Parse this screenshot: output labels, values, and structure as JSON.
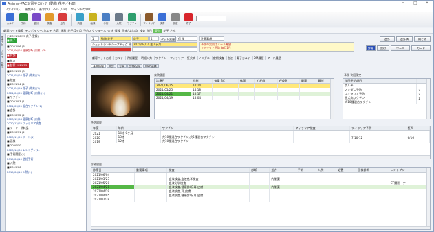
{
  "window": {
    "title": "Animal-PACS 電子カルテ [動物 花子／4/6]",
    "min": "─",
    "max": "□",
    "close": "✕"
  },
  "menu": [
    "ファイル(F)",
    "編集(E)",
    "表示(V)",
    "ヘルプ(H)",
    "ウィンドウ(W)"
  ],
  "toolbar": [
    {
      "label": "カルテ",
      "color": "#3b6fd6"
    },
    {
      "label": "予約",
      "color": "#2d8f3a"
    },
    {
      "label": "会計",
      "color": "#7a4ac7"
    },
    {
      "label": "検査",
      "color": "#e29a2b"
    },
    {
      "label": "処方",
      "color": "#d83c3c"
    },
    {
      "label": "病名",
      "color": "#3aa0c8"
    },
    {
      "label": "画像",
      "color": "#c9b21f"
    },
    {
      "label": "手術",
      "color": "#4b7fc4"
    },
    {
      "label": "入院",
      "color": "#6c7a89"
    },
    {
      "label": "ワクチン",
      "color": "#2f9e6d"
    },
    {
      "label": "フィラリア",
      "color": "#8b5a2b"
    },
    {
      "label": "文書",
      "color": "#3b6fd6"
    },
    {
      "label": "設定",
      "color": "#888888"
    },
    {
      "label": "終了",
      "color": "#d8252b"
    }
  ],
  "bar2": {
    "items": [
      "顧客ペット検索",
      "テンポラリー/カルテ",
      "内容",
      "順番",
      "花子/5ヶ月",
      "予約スケジュール",
      "会計",
      "保険",
      "再来/はな/次",
      "検査 当日",
      "受付",
      "花子 さん"
    ],
    "green_index": 10
  },
  "side": {
    "tabs": [
      "患者ナビ",
      "カルテ",
      "設定"
    ],
    "tree": [
      {
        "t": "□ 2021/06/15 花子(登録)",
        "c": "#222"
      },
      {
        "t": "■ 花子",
        "c": "#fff",
        "bg": "#2fa33a"
      },
      {
        "t": "■ 2021/06 (6)",
        "c": "#222"
      },
      {
        "t": "  2021/06/04 健康診断 (内科) (3)",
        "c": "#c0282f"
      },
      {
        "t": "■ 体調",
        "c": "#fff",
        "bg": "#c0282f"
      },
      {
        "t": "■ 処方",
        "c": "#222"
      },
      {
        "t": "■ 診察 2021/05",
        "c": "#fff",
        "bg": "#c0282f"
      },
      {
        "t": "■ 2021/05 (3)",
        "c": "#222"
      },
      {
        "t": "  2021/05/04 花子 (外来)(1)",
        "c": "#2a4f9e"
      },
      {
        "t": "■ 検査",
        "c": "#222"
      },
      {
        "t": "■ 2021/04 (4)",
        "c": "#222"
      },
      {
        "t": "  2021/04/19 花子 (外来)(1)",
        "c": "#2a4f9e"
      },
      {
        "t": "  2021/04/05 健康診断 (内科)(1)",
        "c": "#2a4f9e"
      },
      {
        "t": "■ ワクチン",
        "c": "#222"
      },
      {
        "t": "■ 2021/03 (1)",
        "c": "#222"
      },
      {
        "t": "  2021/03/05 混合ワクチン(1)",
        "c": "#2a4f9e"
      },
      {
        "t": "■ 会計",
        "c": "#222"
      },
      {
        "t": "■ 2020/12 (2)",
        "c": "#222"
      },
      {
        "t": "  2020/12/08 健康診断 (内科)",
        "c": "#2a4f9e"
      },
      {
        "t": "  2020/12/02 フィラリア検査",
        "c": "#2a4f9e"
      },
      {
        "t": "■ フード・消耗品",
        "c": "#222"
      },
      {
        "t": "■ 2020/11 (2)",
        "c": "#222"
      },
      {
        "t": "  2020/11/09 フード(1)",
        "c": "#2a4f9e"
      },
      {
        "t": "■ 画像",
        "c": "#222"
      },
      {
        "t": "■ 2020/10",
        "c": "#222"
      },
      {
        "t": "  2020/10/30 レントゲン(1)",
        "c": "#2a4f9e"
      },
      {
        "t": "■ 手術履歴 (1)",
        "c": "#222"
      },
      {
        "t": "  2019/06/10 避妊手術",
        "c": "#2a4f9e"
      },
      {
        "t": "■ 入院",
        "c": "#222"
      },
      {
        "t": "■ 2019/06",
        "c": "#222"
      },
      {
        "t": "  2019/06/10 入院(1)",
        "c": "#2a4f9e"
      }
    ]
  },
  "header": {
    "owner_no": "1",
    "owner_name": "動物 花子",
    "pet": "花子",
    "species": "シェットランドシープドッグ 雌",
    "birth": "2021/04/14 生 4ヶ月",
    "pet_no": "4",
    "change_btn": "ペット変更",
    "insurance": "保 険",
    "memo_label": "注意事項",
    "memo": "予防の案内はメール希望",
    "memo2": "フィラリア予防 毎月1日",
    "top_btns": [
      "会計",
      "会計済",
      "閉じる"
    ],
    "row2_btns": [
      "詳細",
      "受付",
      "ツール",
      "カード"
    ]
  },
  "subtoolbar": [
    "顧客ペット台帳",
    "カルテ",
    "明細履歴",
    "明細入力",
    "ワクチン",
    "フィラリア",
    "狂犬病",
    "ノミダニ",
    "定期検査",
    "血液",
    "電子カルテ",
    "DM履歴",
    "フード履歴"
  ],
  "tabs": [
    {
      "label": "基本情報",
      "on": true
    },
    {
      "label": "問診",
      "on": false
    },
    {
      "label": "写真",
      "on": false
    },
    {
      "label": "診療記録",
      "on": false
    },
    {
      "label": "Web連携",
      "on": false
    }
  ],
  "vitals": {
    "title": "来院履歴",
    "cols": [
      "診療日",
      "時刻",
      "体重 BC",
      "体温",
      "心拍数",
      "呼吸数",
      "最高",
      "最低"
    ],
    "rows": [
      [
        "2021/06/15",
        "10:14",
        "",
        "",
        "",
        "",
        "",
        ""
      ],
      [
        "2021/05/25",
        "14:18",
        "",
        "",
        "",
        "",
        "",
        ""
      ],
      [
        "2021/04/21",
        "15:17",
        "",
        "",
        "",
        "",
        "",
        ""
      ],
      [
        "2021/04/19",
        "15:04",
        "",
        "",
        "",
        "",
        "",
        ""
      ]
    ],
    "hl_row": 0,
    "green_row": 2
  },
  "reminder": {
    "title": "予防 次回予定",
    "cols": [
      "次回予防項目",
      ""
    ],
    "rows": [
      [
        "ボルテ",
        ""
      ],
      [
        "ノミダニ予防",
        "2"
      ],
      [
        "フィラリア予防",
        "2"
      ],
      [
        "狂犬病ワクチン",
        "1"
      ],
      [
        "犬10種混合ワクチン",
        ""
      ]
    ]
  },
  "vaccine": {
    "title": "予防履歴",
    "cols": [
      "年度",
      "年齢",
      "ワクチン",
      "フィラリア検査",
      "フィラリア予防",
      "狂犬"
    ],
    "rows": [
      [
        "2021",
        "14才 0ヶ月",
        "",
        "",
        "",
        ""
      ],
      [
        "2020",
        "13才",
        "犬10種混合ワクチン,犬5種混合ワクチン",
        "",
        "7.10-12",
        "6/16"
      ],
      [
        "2019",
        "12才",
        "犬10種混合ワクチン",
        "",
        "",
        ""
      ]
    ]
  },
  "history": {
    "title": "診療履歴",
    "cols": [
      "診療日",
      "重要事項",
      "検査",
      "診断",
      "処方",
      "手術",
      "入院",
      "処置",
      "画像診断",
      "レントゲン"
    ],
    "rows": [
      [
        "2021/06/04",
        "",
        "",
        "",
        "",
        "",
        "",
        "",
        "",
        ""
      ],
      [
        "2021/05/25",
        "",
        "血液検査,血液化学検査",
        "",
        "内服薬",
        "",
        "",
        "",
        "",
        ""
      ],
      [
        "2021/05/20",
        "",
        "血液化学検査",
        "",
        "",
        "",
        "",
        "",
        "",
        "CT撮影ーナ"
      ],
      [
        "2021/04/21",
        "",
        "血液検査,健康診断,耳,皮膚",
        "",
        "内服薬",
        "",
        "",
        "",
        "",
        ""
      ],
      [
        "2021/04/19",
        "",
        "血液検査,耳,皮膚",
        "",
        "",
        "",
        "",
        "",
        "",
        ""
      ],
      [
        "2021/04/05",
        "",
        "血液検査,健康診断,耳,皮膚",
        "",
        "",
        "",
        "",
        "",
        "",
        ""
      ],
      [
        "2021/02/28",
        "",
        "",
        "",
        "",
        "",
        "",
        "",
        "",
        ""
      ]
    ],
    "green_row": 3
  }
}
